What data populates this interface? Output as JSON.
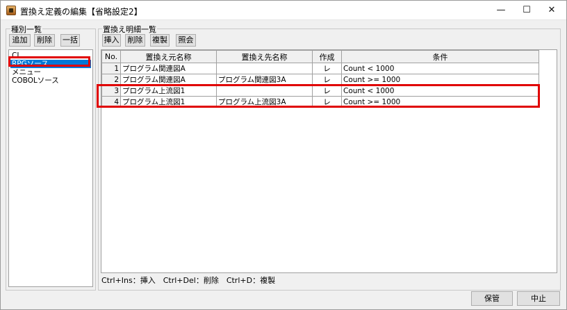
{
  "window": {
    "title": "置換え定義の編集【省略設定2】",
    "min_glyph": "—",
    "max_glyph": "☐",
    "close_glyph": "✕"
  },
  "type_list": {
    "label": "種別一覧",
    "buttons": {
      "add": "追加",
      "delete": "削除",
      "bulk": "一括"
    },
    "items": [
      "CL",
      "RPGソース",
      "メニュー",
      "COBOLソース"
    ],
    "selected_index": 1
  },
  "detail": {
    "label": "置換え明細一覧",
    "buttons": {
      "insert": "挿入",
      "delete": "削除",
      "copy": "複製",
      "lookup": "照会"
    },
    "columns": [
      "No.",
      "置換え元名称",
      "置換え先名称",
      "作成",
      "条件"
    ],
    "rows": [
      {
        "no": "1",
        "src": "プログラム関連図A",
        "dst": "",
        "create": "レ",
        "cond": "Count < 1000"
      },
      {
        "no": "2",
        "src": "プログラム関連図A",
        "dst": "プログラム関連図3A",
        "create": "レ",
        "cond": "Count >= 1000"
      },
      {
        "no": "3",
        "src": "プログラム上流図1",
        "dst": "",
        "create": "レ",
        "cond": "Count < 1000"
      },
      {
        "no": "4",
        "src": "プログラム上流図1",
        "dst": "プログラム上流図3A",
        "create": "レ",
        "cond": "Count >= 1000"
      }
    ],
    "shortcut_hint": "Ctrl+Ins：挿入　Ctrl+Del：削除　Ctrl+D：複製"
  },
  "footer": {
    "save": "保管",
    "cancel": "中止"
  },
  "colors": {
    "highlight": "#e00000",
    "selection": "#0078d7"
  }
}
